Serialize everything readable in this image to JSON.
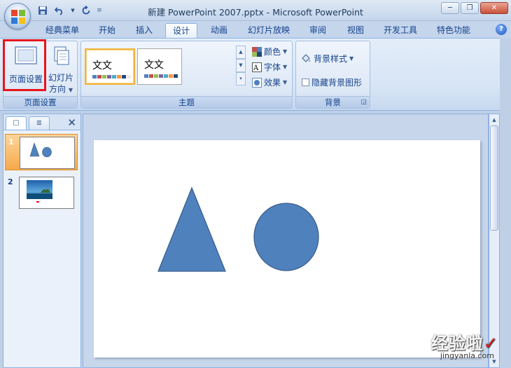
{
  "window": {
    "title": "新建 PowerPoint 2007.pptx - Microsoft PowerPoint",
    "minimize_label": "─",
    "restore_label": "❐",
    "close_label": "✕"
  },
  "quick_access": {
    "save_icon": "save-icon",
    "undo_icon": "undo-icon",
    "redo_icon": "redo-icon",
    "customize_label": "▼"
  },
  "tabs": [
    {
      "label": "经典菜单"
    },
    {
      "label": "开始"
    },
    {
      "label": "插入"
    },
    {
      "label": "设计",
      "active": true
    },
    {
      "label": "动画"
    },
    {
      "label": "幻灯片放映"
    },
    {
      "label": "审阅"
    },
    {
      "label": "视图"
    },
    {
      "label": "开发工具"
    },
    {
      "label": "特色功能"
    }
  ],
  "help_label": "?",
  "ribbon": {
    "page_setup_group": {
      "label": "页面设置",
      "page_setup_button": "页面设置",
      "slide_orientation_line1": "幻灯片",
      "slide_orientation_line2": "方向"
    },
    "themes_group": {
      "label": "主题",
      "theme1_text": "文文",
      "theme2_text": "文文",
      "colors_label": "颜色",
      "fonts_label": "字体",
      "effects_label": "效果",
      "swatch_colors": [
        "#4f81bd",
        "#c0504d",
        "#9bbb59",
        "#8064a2",
        "#4bacc6",
        "#f79646"
      ]
    },
    "background_group": {
      "label": "背景",
      "background_styles_label": "背景样式",
      "hide_background_label": "隐藏背景图形",
      "hide_background_checked": false
    }
  },
  "slide_panel": {
    "tab_slides_icon": "slides-tab-icon",
    "tab_outline_icon": "outline-tab-icon",
    "close_label": "✕",
    "slides": [
      {
        "number": "1",
        "selected": true
      },
      {
        "number": "2",
        "selected": false
      }
    ]
  },
  "slide": {
    "shape_color": "#4f81bd",
    "shape_stroke": "#3a5f8d"
  },
  "watermark": {
    "text": "经验啦",
    "check": "✓",
    "url": "jingyanla.com"
  }
}
